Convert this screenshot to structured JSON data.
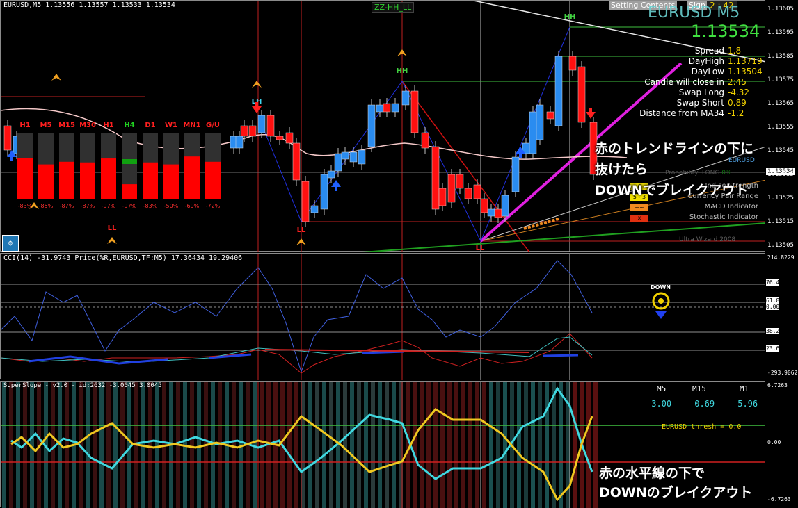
{
  "main": {
    "header": "EURUSD,M5  1.13556 1.13557 1.13533 1.13534",
    "zz_label": "ZZ-HH_LL",
    "setting_btn": "Setting Contents",
    "sign_btn": "Sign No",
    "timer": "2 : 42",
    "symbol_big": "EURUSD M5",
    "price_big": "1.13534",
    "info": [
      {
        "label": "Spread",
        "value": "1.8"
      },
      {
        "label": "DayHigh",
        "value": "1.13719"
      },
      {
        "label": "DayLow",
        "value": "1.13504"
      },
      {
        "label": "Candle will close in",
        "value": "2:45"
      },
      {
        "label": "Swap Long",
        "value": "-4.32"
      },
      {
        "label": "Swap Short",
        "value": "0.89"
      },
      {
        "label": "Distance from MA34",
        "value": "-1.2"
      }
    ],
    "wizard": {
      "pair": "EURUSD",
      "probability_label": "Probability:",
      "probability_dir": "LONG",
      "probability_val": "0%",
      "rows": [
        {
          "badge": "6",
          "label": "Indice Strength"
        },
        {
          "badge": "5 - 3",
          "label": "Currency Pair Range"
        },
        {
          "badge": "~~",
          "label": "MACD Indicator"
        },
        {
          "badge": "x",
          "label": "Stochastic Indicator"
        }
      ],
      "footer": "Ultra Wizard 2008"
    },
    "tf_labels": [
      "H1",
      "M5",
      "M15",
      "M30",
      "H1",
      "H4",
      "D1",
      "W1",
      "MN1",
      "G/U"
    ],
    "tf_percent": [
      "-83%",
      "-85%",
      "-87%",
      "-87%",
      "-97%",
      "-97%",
      "-83%",
      "-50%",
      "-69%",
      "-72%"
    ],
    "tf_red_fraction": [
      0.62,
      0.52,
      0.56,
      0.55,
      0.61,
      0.22,
      0.55,
      0.52,
      0.64,
      0.56
    ],
    "markers": [
      "LH",
      "HH",
      "HH",
      "LL",
      "LL",
      "LL"
    ],
    "price_ticks": [
      "1.13605",
      "1.13595",
      "1.13585",
      "1.13575",
      "1.13565",
      "1.13555",
      "1.13545",
      "1.13535",
      "1.13525",
      "1.13515",
      "1.13505"
    ],
    "current_price": "1.13534",
    "annotation1": [
      "赤のトレンドラインの下に",
      "抜けたら",
      "DOWNでブレイクアウト"
    ]
  },
  "cci": {
    "header": "CCI(14) -31.9743  Price(%R,EURUSD,TF:M5) 17.36434 19.29406",
    "signal": "DOWN",
    "ticks": [
      "214.8229",
      "76.4",
      "61.8",
      "0.00",
      "38.2",
      "23.6",
      "-293.9062"
    ]
  },
  "slope": {
    "header": "SuperSlope - v2.0 - id:2632 -3.0045 3.0045",
    "tf_names": [
      "M5",
      "M15",
      "M1"
    ],
    "tf_values": [
      "-3.00",
      "-0.69",
      "-5.96"
    ],
    "thresh": "EURUSD thresh = 0.0",
    "ticks": [
      "6.7263",
      "0.00",
      "-6.7263"
    ],
    "annotation2": [
      "赤の水平線の下で",
      "DOWNのブレイクアウト"
    ]
  },
  "colors": {
    "bull": "#2a8cf0",
    "bear": "#ff1010",
    "cyan": "#40e0e0",
    "yellow": "#f0c020",
    "magenta": "#e020e0",
    "hline_green": "#40c040",
    "hline_red": "#d02020"
  }
}
